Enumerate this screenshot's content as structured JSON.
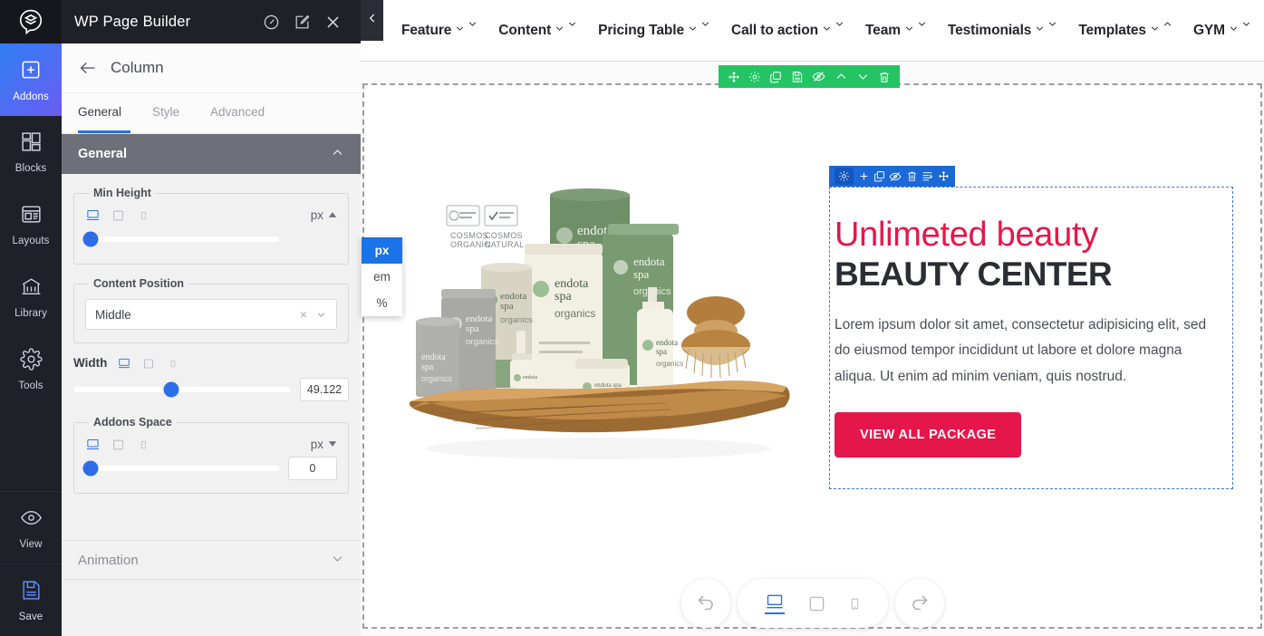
{
  "rail": {
    "logo_icon": "wp-page-builder-logo",
    "items": [
      {
        "label": "Addons",
        "icon": "plus-square-icon",
        "active": true
      },
      {
        "label": "Blocks",
        "icon": "blocks-grid-icon",
        "active": false
      },
      {
        "label": "Layouts",
        "icon": "layouts-window-icon",
        "active": false
      },
      {
        "label": "Library",
        "icon": "library-building-icon",
        "active": false
      },
      {
        "label": "Tools",
        "icon": "gear-icon",
        "active": false
      }
    ],
    "bottom_items": [
      {
        "label": "View",
        "icon": "eye-icon"
      },
      {
        "label": "Save",
        "icon": "floppy-disk-icon"
      }
    ]
  },
  "panel": {
    "app_title": "WP Page Builder",
    "header_icons": [
      "gauge-icon",
      "edit-square-icon",
      "close-icon"
    ],
    "back_icon": "arrow-left-icon",
    "section_title": "Column",
    "tabs": [
      {
        "label": "General",
        "active": true
      },
      {
        "label": "Style",
        "active": false
      },
      {
        "label": "Advanced",
        "active": false
      }
    ],
    "general_section": {
      "label": "General",
      "chevron": "chevron-up-icon",
      "min_height": {
        "legend": "Min Height",
        "unit": "px",
        "unit_caret": "caret-up-icon",
        "slider_percent": 3,
        "devices": [
          "desktop-icon",
          "tablet-icon",
          "mobile-icon"
        ],
        "active_device": "desktop-icon",
        "unit_options": [
          {
            "label": "px",
            "selected": true
          },
          {
            "label": "em",
            "selected": false
          },
          {
            "label": "%",
            "selected": false
          }
        ]
      },
      "content_position": {
        "legend": "Content Position",
        "value": "Middle",
        "clear_icon": "close-small-icon",
        "chevron": "chevron-down-icon"
      },
      "width": {
        "label": "Width",
        "value": "49.122",
        "slider_percent": 45,
        "devices": [
          "desktop-icon",
          "tablet-icon",
          "mobile-icon"
        ],
        "active_device": "desktop-icon"
      },
      "addons_space": {
        "legend": "Addons Space",
        "unit": "px",
        "unit_caret": "caret-down-icon",
        "value": "0",
        "slider_percent": 3,
        "devices": [
          "desktop-icon",
          "tablet-icon",
          "mobile-icon"
        ],
        "active_device": "desktop-icon"
      }
    },
    "animation_section": {
      "label": "Animation",
      "chevron": "chevron-down-icon"
    }
  },
  "canvas": {
    "collapse_icon": "chevron-left-icon",
    "topnav": [
      {
        "label": "Feature",
        "chevron1": "chevron-down-icon",
        "chevron2": "chevron-down-icon"
      },
      {
        "label": "Content",
        "chevron1": "chevron-down-icon",
        "chevron2": "chevron-down-icon"
      },
      {
        "label": "Pricing Table",
        "chevron1": "chevron-down-icon",
        "chevron2": "chevron-down-icon"
      },
      {
        "label": "Call to action",
        "chevron1": "chevron-down-icon",
        "chevron2": "chevron-down-icon"
      },
      {
        "label": "Team",
        "chevron1": "chevron-down-icon",
        "chevron2": "chevron-down-icon"
      },
      {
        "label": "Testimonials",
        "chevron1": "chevron-down-icon",
        "chevron2": "chevron-down-icon"
      },
      {
        "label": "Templates",
        "chevron1": "chevron-down-icon",
        "chevron2": "chevron-up-icon"
      },
      {
        "label": "GYM",
        "chevron1": "chevron-down-icon",
        "chevron2": "chevron-down-icon"
      }
    ],
    "row_toolbar": {
      "color": "#24c464",
      "icons": [
        "move-icon",
        "gear-icon",
        "copy-icon",
        "save-icon",
        "eye-off-icon",
        "chevron-up-icon",
        "chevron-down-icon",
        "trash-icon"
      ]
    },
    "column_toolbar": {
      "color": "#1b69d8",
      "icons": [
        "gear-icon",
        "plus-icon",
        "copy-icon",
        "eye-off-icon",
        "trash-icon",
        "indent-icon",
        "move-icon"
      ]
    },
    "content": {
      "image_alt": "endota spa organics skincare product set on wooden slab",
      "image_badges": [
        "COSMOS ORGANIC",
        "COSMOS NATURAL"
      ],
      "image_brand": "endota spa organics",
      "script_heading": "Unlimeted beauty",
      "main_heading": "BEAUTY CENTER",
      "paragraph": "Lorem ipsum dolor sit amet, consectetur adipisicing elit, sed do eiusmod tempor incididunt ut labore et dolore magna aliqua. Ut enim ad minim veniam, quis nostrud.",
      "cta_label": "VIEW ALL PACKAGE",
      "accent_color": "#e5174a"
    },
    "bottom_bar": {
      "undo_icon": "undo-icon",
      "redo_icon": "redo-icon",
      "devices": [
        {
          "icon": "desktop-icon",
          "active": true
        },
        {
          "icon": "tablet-icon",
          "active": false
        },
        {
          "icon": "mobile-icon",
          "active": false
        }
      ]
    }
  }
}
